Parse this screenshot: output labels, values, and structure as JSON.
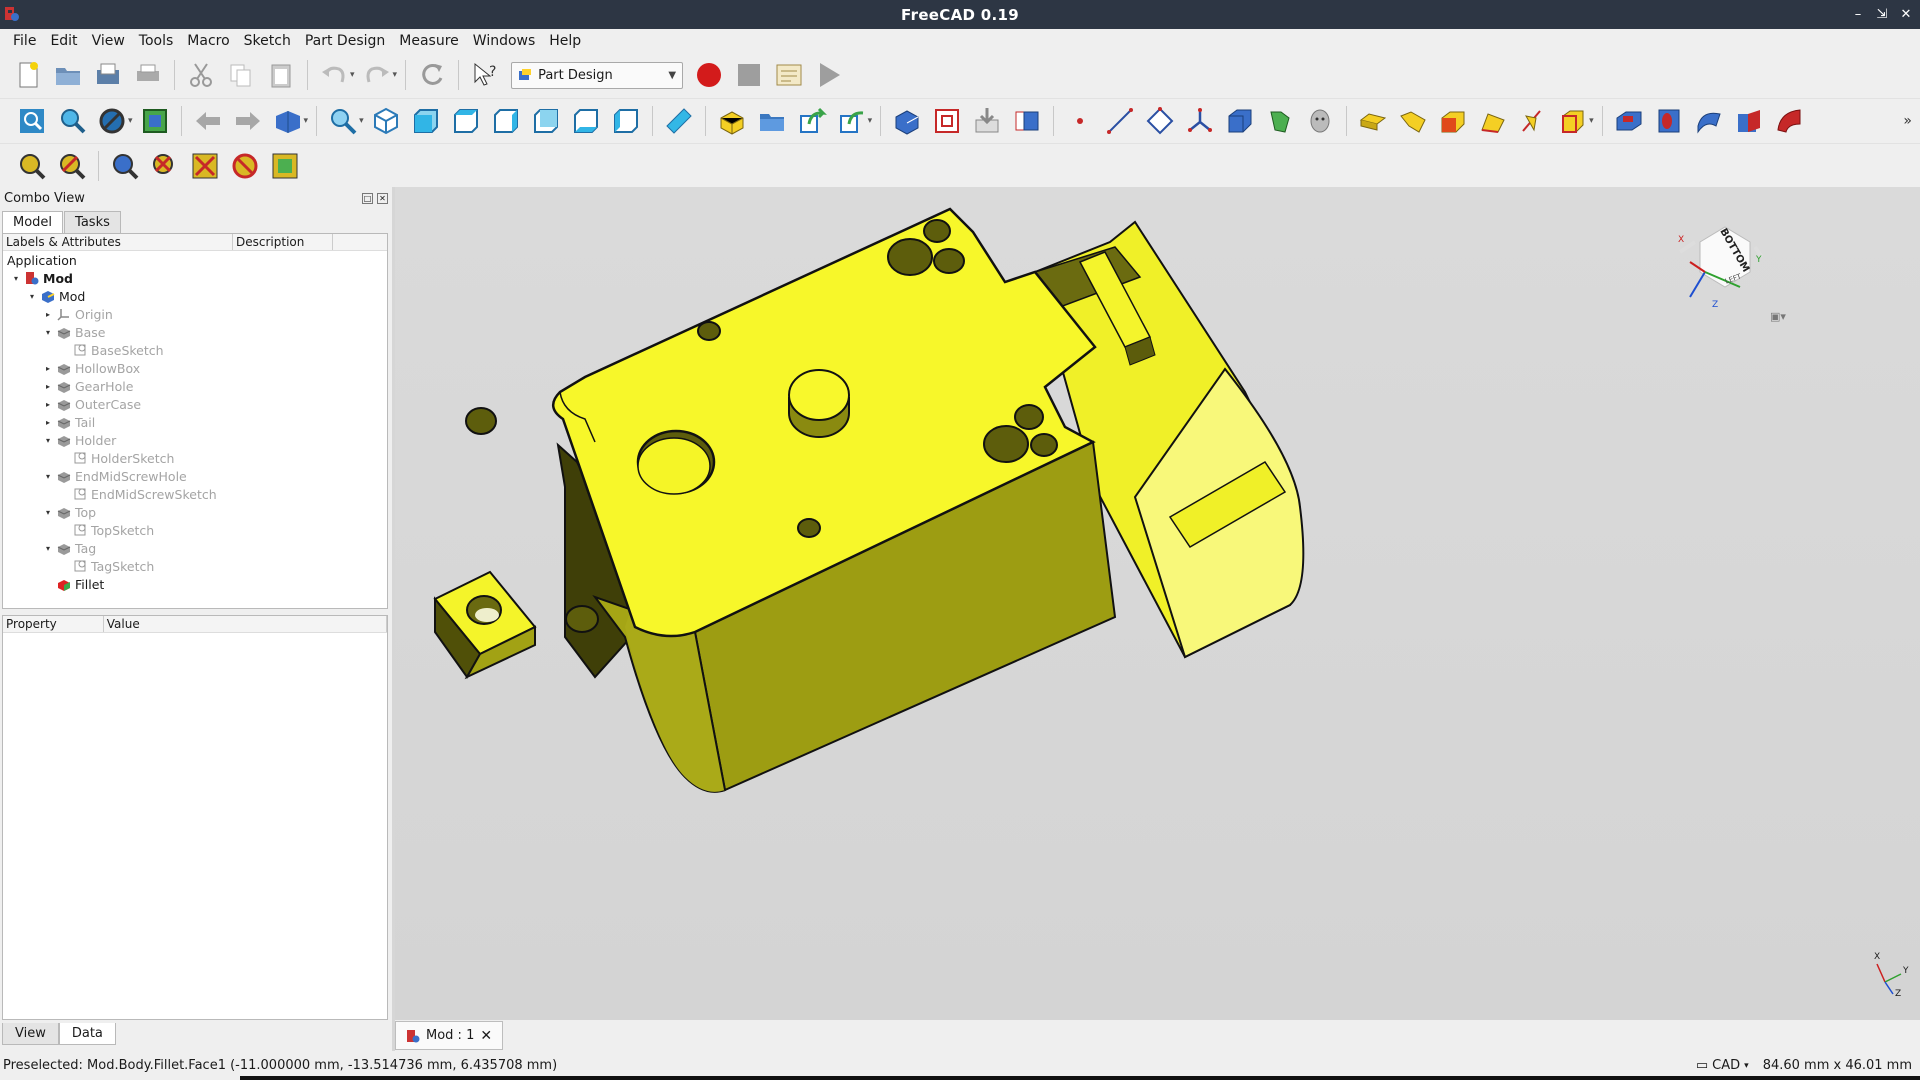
{
  "window": {
    "title": "FreeCAD 0.19"
  },
  "menu": [
    "File",
    "Edit",
    "View",
    "Tools",
    "Macro",
    "Sketch",
    "Part Design",
    "Measure",
    "Windows",
    "Help"
  ],
  "workbench": {
    "selected": "Part Design"
  },
  "combo": {
    "title": "Combo View",
    "tabs": [
      "Model",
      "Tasks"
    ],
    "tree_columns": [
      "Labels & Attributes",
      "Description"
    ],
    "tree_root": "Application",
    "tree": [
      {
        "label": "Mod",
        "level": 0,
        "exp": "open",
        "style": "bold",
        "icon": "document-icon"
      },
      {
        "label": "Mod",
        "level": 1,
        "exp": "open",
        "style": "normal",
        "icon": "body-icon"
      },
      {
        "label": "Origin",
        "level": 2,
        "exp": "closed",
        "style": "dim",
        "icon": "origin-icon"
      },
      {
        "label": "Base",
        "level": 2,
        "exp": "open",
        "style": "dim",
        "icon": "feature-icon"
      },
      {
        "label": "BaseSketch",
        "level": 3,
        "exp": "none",
        "style": "dim",
        "icon": "sketch-icon"
      },
      {
        "label": "HollowBox",
        "level": 2,
        "exp": "closed",
        "style": "dim",
        "icon": "feature-icon"
      },
      {
        "label": "GearHole",
        "level": 2,
        "exp": "closed",
        "style": "dim",
        "icon": "feature-icon"
      },
      {
        "label": "OuterCase",
        "level": 2,
        "exp": "closed",
        "style": "dim",
        "icon": "feature-icon"
      },
      {
        "label": "Tail",
        "level": 2,
        "exp": "closed",
        "style": "dim",
        "icon": "feature-icon"
      },
      {
        "label": "Holder",
        "level": 2,
        "exp": "open",
        "style": "dim",
        "icon": "feature-icon"
      },
      {
        "label": "HolderSketch",
        "level": 3,
        "exp": "none",
        "style": "dim",
        "icon": "sketch-icon"
      },
      {
        "label": "EndMidScrewHole",
        "level": 2,
        "exp": "open",
        "style": "dim",
        "icon": "feature-icon"
      },
      {
        "label": "EndMidScrewSketch",
        "level": 3,
        "exp": "none",
        "style": "dim",
        "icon": "sketch-icon"
      },
      {
        "label": "Top",
        "level": 2,
        "exp": "open",
        "style": "dim",
        "icon": "feature-icon"
      },
      {
        "label": "TopSketch",
        "level": 3,
        "exp": "none",
        "style": "dim",
        "icon": "sketch-icon"
      },
      {
        "label": "Tag",
        "level": 2,
        "exp": "open",
        "style": "dim",
        "icon": "feature-icon"
      },
      {
        "label": "TagSketch",
        "level": 3,
        "exp": "none",
        "style": "dim",
        "icon": "sketch-icon"
      },
      {
        "label": "Fillet",
        "level": 2,
        "exp": "none",
        "style": "normal",
        "icon": "fillet-icon"
      }
    ],
    "prop_columns": [
      "Property",
      "Value"
    ],
    "bottom_tabs": [
      "View",
      "Data"
    ]
  },
  "navcube": {
    "face": "BOTTOM",
    "side": "LEFT",
    "axes": [
      "X",
      "Y",
      "Z"
    ]
  },
  "axis_cross": [
    "X",
    "Y",
    "Z"
  ],
  "doc_tab": "Mod : 1",
  "status": {
    "left": "Preselected: Mod.Body.Fillet.Face1 (-11.000000 mm, -13.514736 mm, 6.435708 mm)",
    "nav_style": "CAD",
    "dimensions": "84.60 mm x 46.01 mm"
  },
  "colors": {
    "part_top": "#f6f62a",
    "part_side": "#9c9c12",
    "part_dark": "#3f3f08",
    "titlebar": "#2d3644"
  }
}
